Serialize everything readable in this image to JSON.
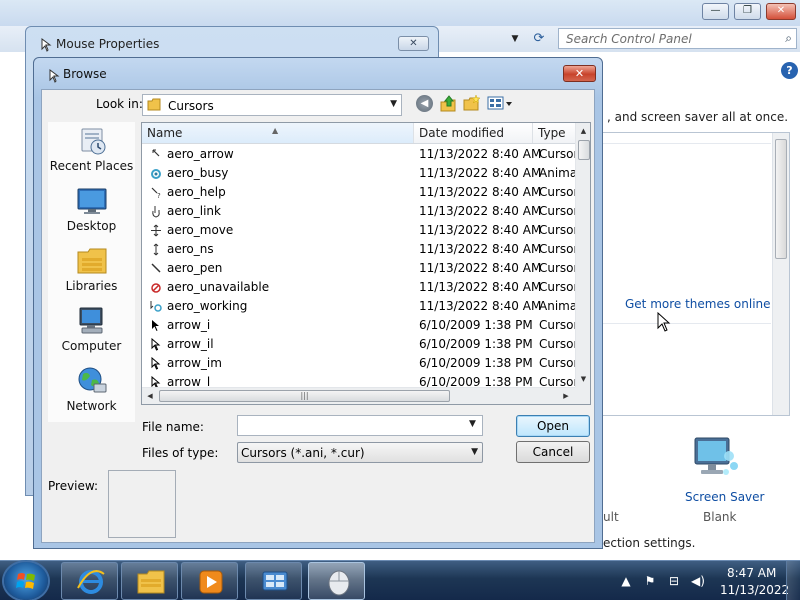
{
  "control_panel": {
    "search_placeholder": "Search Control Panel",
    "intro_text": ", and screen saver all at once.",
    "get_more_themes": "Get more themes online",
    "screen_saver_label": "Screen Saver",
    "screen_saver_value": "Blank",
    "sound_value": "ult",
    "bottom_text": "ection settings.",
    "help_icon": "?",
    "window_buttons": {
      "minimize": "—",
      "maximize": "❐",
      "close": "✕"
    }
  },
  "mouse_properties": {
    "title": "Mouse Properties",
    "close_glyph": "✕"
  },
  "browse_dialog": {
    "title": "Browse",
    "close_glyph": "✕",
    "look_in_label": "Look in:",
    "look_in_value": "Cursors",
    "places": [
      {
        "label": "Recent Places",
        "icon": "recent-places-icon"
      },
      {
        "label": "Desktop",
        "icon": "desktop-icon"
      },
      {
        "label": "Libraries",
        "icon": "libraries-icon"
      },
      {
        "label": "Computer",
        "icon": "computer-icon"
      },
      {
        "label": "Network",
        "icon": "network-icon"
      }
    ],
    "columns": {
      "name": "Name",
      "date": "Date modified",
      "type": "Type"
    },
    "files": [
      {
        "name": "aero_arrow",
        "date": "11/13/2022 8:40 AM",
        "type": "Cursor"
      },
      {
        "name": "aero_busy",
        "date": "11/13/2022 8:40 AM",
        "type": "Animated"
      },
      {
        "name": "aero_help",
        "date": "11/13/2022 8:40 AM",
        "type": "Cursor"
      },
      {
        "name": "aero_link",
        "date": "11/13/2022 8:40 AM",
        "type": "Cursor"
      },
      {
        "name": "aero_move",
        "date": "11/13/2022 8:40 AM",
        "type": "Cursor"
      },
      {
        "name": "aero_ns",
        "date": "11/13/2022 8:40 AM",
        "type": "Cursor"
      },
      {
        "name": "aero_pen",
        "date": "11/13/2022 8:40 AM",
        "type": "Cursor"
      },
      {
        "name": "aero_unavailable",
        "date": "11/13/2022 8:40 AM",
        "type": "Cursor"
      },
      {
        "name": "aero_working",
        "date": "11/13/2022 8:40 AM",
        "type": "Animated"
      },
      {
        "name": "arrow_i",
        "date": "6/10/2009 1:38 PM",
        "type": "Cursor"
      },
      {
        "name": "arrow_il",
        "date": "6/10/2009 1:38 PM",
        "type": "Cursor"
      },
      {
        "name": "arrow_im",
        "date": "6/10/2009 1:38 PM",
        "type": "Cursor"
      },
      {
        "name": "arrow_l",
        "date": "6/10/2009 1:38 PM",
        "type": "Cursor"
      }
    ],
    "file_name_label": "File name:",
    "file_name_value": "",
    "files_of_type_label": "Files of type:",
    "files_of_type_value": "Cursors (*.ani, *.cur)",
    "open_label": "Open",
    "cancel_label": "Cancel",
    "preview_label": "Preview:"
  },
  "taskbar": {
    "apps": [
      "internet-explorer",
      "windows-explorer",
      "media-player",
      "control-panel",
      "mouse-properties"
    ],
    "clock_time": "8:47 AM",
    "clock_date": "11/13/2022"
  },
  "colors": {
    "link": "#0f4ea3",
    "dialog_frame": "#a9c5e5",
    "close_red": "#c8432b",
    "taskbar": "#1d3654"
  }
}
